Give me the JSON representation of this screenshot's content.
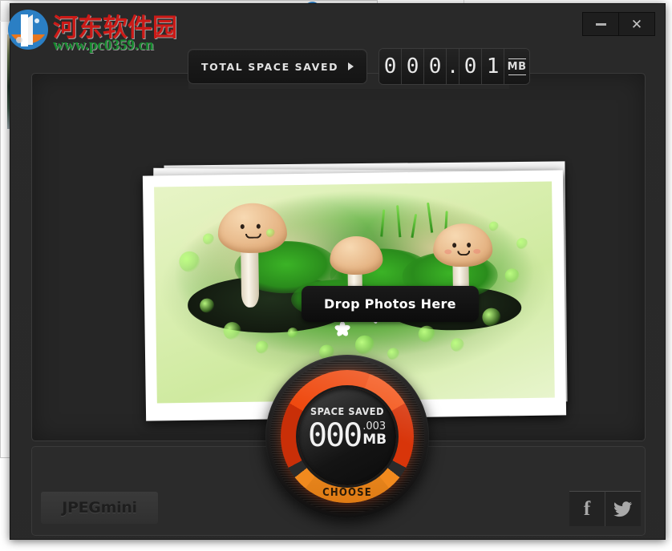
{
  "background": {
    "chevron_icon": "chevron-down-icon",
    "help_icon": "help-question-icon",
    "help_label": "?"
  },
  "watermark": {
    "site_name": "河东软件园",
    "url": "www.pc0359.cn"
  },
  "window": {
    "minimize_label": "",
    "close_label": "✕"
  },
  "header": {
    "total_label": "TOTAL SPACE SAVED",
    "digits": [
      "0",
      "0",
      "0",
      ".",
      "0",
      "1"
    ],
    "unit": "MB"
  },
  "main": {
    "drop_label": "Drop Photos Here"
  },
  "gauge": {
    "title": "SPACE SAVED",
    "integer": "000",
    "fraction": ".003",
    "unit": "MB",
    "choose_label": "CHOOSE",
    "ring_color": "#ef4a10",
    "choose_color": "#f0901f"
  },
  "footer": {
    "logo_text": "JPEGmini",
    "facebook_glyph": "f",
    "twitter_icon": "twitter-bird-icon"
  }
}
